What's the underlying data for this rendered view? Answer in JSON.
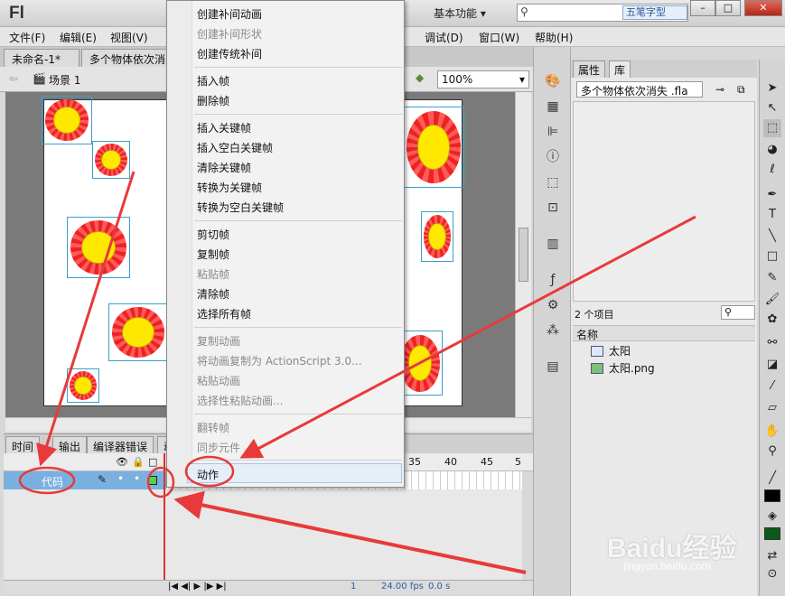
{
  "app": {
    "logo": "Fl",
    "workspace": "基本功能 ▾"
  },
  "search": {
    "placeholder": "",
    "ime": "五笔字型"
  },
  "window": {
    "min": "–",
    "max": "□",
    "close": "✕"
  },
  "menu": {
    "file": "文件(F)",
    "edit": "编辑(E)",
    "view": "视图(V)",
    "debug": "调试(D)",
    "window": "窗口(W)",
    "help": "帮助(H)"
  },
  "doc_tabs": [
    "未命名-1*",
    "多个物体依次消"
  ],
  "editbar": {
    "scene": "场景 1",
    "zoom": "100%"
  },
  "context_menu": {
    "items": [
      {
        "label": "创建补间动画",
        "enabled": true
      },
      {
        "label": "创建补间形状",
        "enabled": false
      },
      {
        "label": "创建传统补间",
        "enabled": true
      },
      {
        "label": "插入帧",
        "enabled": true
      },
      {
        "label": "删除帧",
        "enabled": true
      },
      {
        "label": "插入关键帧",
        "enabled": true
      },
      {
        "label": "插入空白关键帧",
        "enabled": true
      },
      {
        "label": "清除关键帧",
        "enabled": true
      },
      {
        "label": "转换为关键帧",
        "enabled": true
      },
      {
        "label": "转换为空白关键帧",
        "enabled": true
      },
      {
        "label": "剪切帧",
        "enabled": true
      },
      {
        "label": "复制帧",
        "enabled": true
      },
      {
        "label": "粘贴帧",
        "enabled": false
      },
      {
        "label": "清除帧",
        "enabled": true
      },
      {
        "label": "选择所有帧",
        "enabled": true
      },
      {
        "label": "复制动画",
        "enabled": false
      },
      {
        "label": "将动画复制为 ActionScript 3.0...",
        "enabled": false
      },
      {
        "label": "粘贴动画",
        "enabled": false
      },
      {
        "label": "选择性粘贴动画...",
        "enabled": false
      },
      {
        "label": "翻转帧",
        "enabled": false
      },
      {
        "label": "同步元件",
        "enabled": false
      },
      {
        "label": "动作",
        "enabled": true
      }
    ]
  },
  "timeline": {
    "tabs": [
      "时间",
      "输出",
      "编译器错误",
      "动"
    ],
    "frame_numbers": [
      "35",
      "40",
      "45",
      "5"
    ],
    "layer": "代码",
    "status": {
      "frame": "1",
      "fps": "24.00 fps",
      "time": "0.0 s"
    }
  },
  "library": {
    "tabs": [
      "属性",
      "库"
    ],
    "selected_file": "多个物体依次消失 .fla",
    "count": "2 个项目",
    "column": "名称",
    "items": [
      {
        "name": "太阳",
        "type": "movieclip"
      },
      {
        "name": "太阳.png",
        "type": "bitmap"
      }
    ]
  },
  "watermark": {
    "brand": "Baidu经验",
    "url": "jingyan.baidu.com"
  },
  "colors": {
    "arrow": "#e83a3a",
    "keyframe": "#4fd24f",
    "layer": "#7ab0e0"
  }
}
